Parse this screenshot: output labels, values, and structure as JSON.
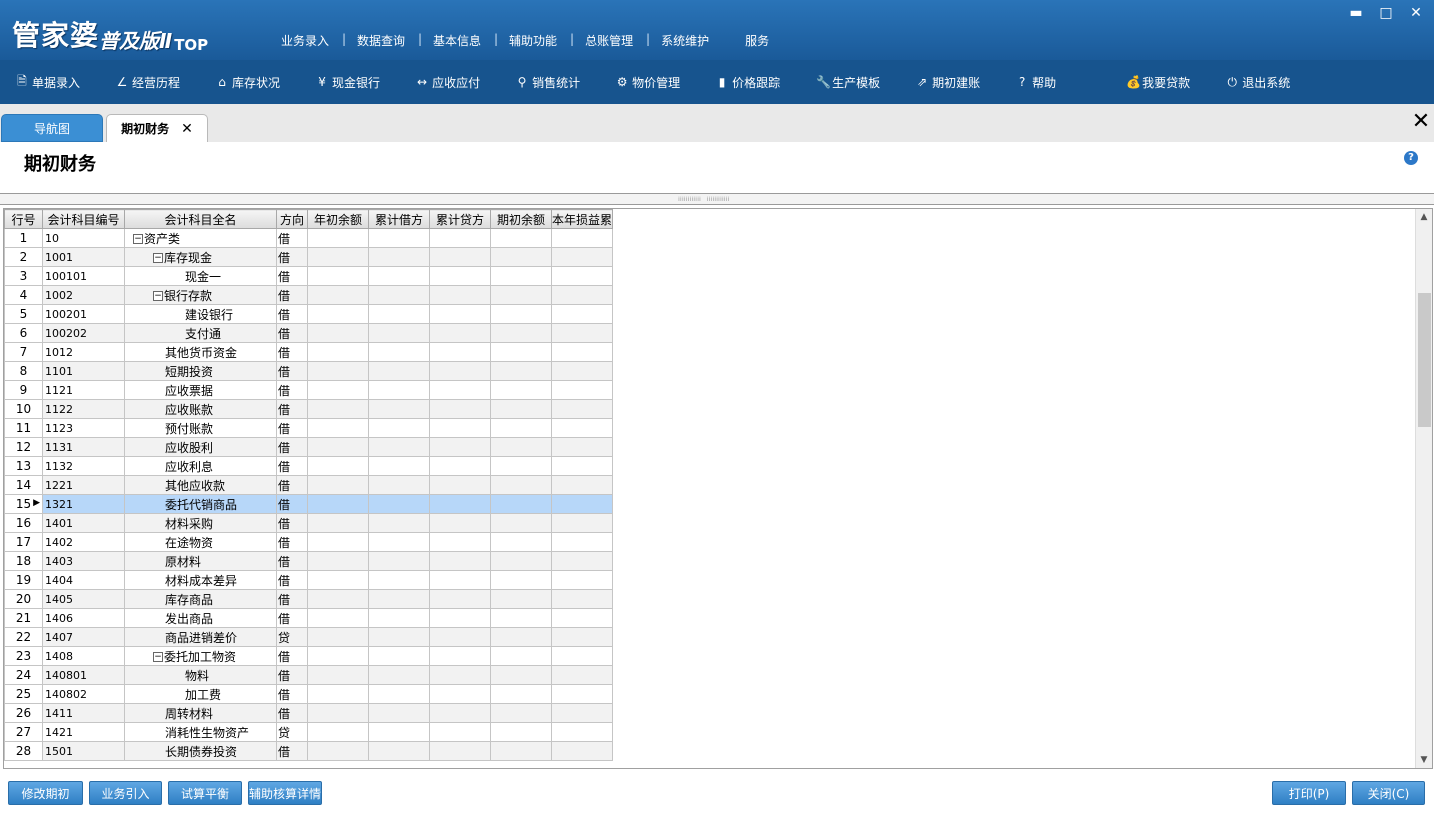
{
  "app": {
    "logo_main": "管家婆",
    "logo_sub": "普及版Ⅱ",
    "logo_top": "TOP"
  },
  "top_menu": [
    "业务录入",
    "数据查询",
    "基本信息",
    "辅助功能",
    "总账管理",
    "系统维护",
    "服务"
  ],
  "window_controls": {
    "minimize": "▬",
    "maximize": "□",
    "close": "✕"
  },
  "toolbar": [
    {
      "icon": "document-icon",
      "glyph": "🗎",
      "label": "单据录入"
    },
    {
      "icon": "line-chart-icon",
      "glyph": "∠",
      "label": "经营历程"
    },
    {
      "icon": "home-icon",
      "glyph": "⌂",
      "label": "库存状况"
    },
    {
      "icon": "yen-icon",
      "glyph": "¥",
      "label": "现金银行"
    },
    {
      "icon": "exchange-icon",
      "glyph": "↔",
      "label": "应收应付"
    },
    {
      "icon": "search-icon",
      "glyph": "⚲",
      "label": "销售统计"
    },
    {
      "icon": "gear-icon",
      "glyph": "⚙",
      "label": "物价管理"
    },
    {
      "icon": "bar-chart-icon",
      "glyph": "▮",
      "label": "价格跟踪"
    },
    {
      "icon": "wrench-icon",
      "glyph": "🔧",
      "label": "生产模板"
    },
    {
      "icon": "external-link-icon",
      "glyph": "⇗",
      "label": "期初建账"
    },
    {
      "icon": "question-icon",
      "glyph": "?",
      "label": "帮助"
    },
    {
      "icon": "money-bag-icon",
      "glyph": "💰",
      "label": "我要贷款"
    },
    {
      "icon": "power-icon",
      "glyph": "⏻",
      "label": "退出系统"
    }
  ],
  "tabs": {
    "nav": "导航图",
    "current": "期初财务",
    "close_glyph": "✕",
    "close_all_glyph": "✕"
  },
  "page": {
    "title": "期初财务",
    "help_glyph": "?"
  },
  "grid": {
    "headers": [
      "行号",
      "会计科目编号",
      "会计科目全名",
      "方向",
      "年初余额",
      "累计借方",
      "累计贷方",
      "期初余额",
      "本年损益累"
    ],
    "rows": [
      {
        "n": "1",
        "code": "10",
        "name": "资产类",
        "dir": "借",
        "level": 0,
        "toggle": "⊟"
      },
      {
        "n": "2",
        "code": "1001",
        "name": "库存现金",
        "dir": "借",
        "level": 1,
        "toggle": "⊟"
      },
      {
        "n": "3",
        "code": "100101",
        "name": "现金一",
        "dir": "借",
        "level": 2,
        "toggle": ""
      },
      {
        "n": "4",
        "code": "1002",
        "name": "银行存款",
        "dir": "借",
        "level": 1,
        "toggle": "⊟"
      },
      {
        "n": "5",
        "code": "100201",
        "name": "建设银行",
        "dir": "借",
        "level": 2,
        "toggle": ""
      },
      {
        "n": "6",
        "code": "100202",
        "name": "支付通",
        "dir": "借",
        "level": 2,
        "toggle": ""
      },
      {
        "n": "7",
        "code": "1012",
        "name": "其他货币资金",
        "dir": "借",
        "level": 1,
        "toggle": ""
      },
      {
        "n": "8",
        "code": "1101",
        "name": "短期投资",
        "dir": "借",
        "level": 1,
        "toggle": ""
      },
      {
        "n": "9",
        "code": "1121",
        "name": "应收票据",
        "dir": "借",
        "level": 1,
        "toggle": ""
      },
      {
        "n": "10",
        "code": "1122",
        "name": "应收账款",
        "dir": "借",
        "level": 1,
        "toggle": ""
      },
      {
        "n": "11",
        "code": "1123",
        "name": "预付账款",
        "dir": "借",
        "level": 1,
        "toggle": ""
      },
      {
        "n": "12",
        "code": "1131",
        "name": "应收股利",
        "dir": "借",
        "level": 1,
        "toggle": ""
      },
      {
        "n": "13",
        "code": "1132",
        "name": "应收利息",
        "dir": "借",
        "level": 1,
        "toggle": ""
      },
      {
        "n": "14",
        "code": "1221",
        "name": "其他应收款",
        "dir": "借",
        "level": 1,
        "toggle": ""
      },
      {
        "n": "15",
        "code": "1321",
        "name": "委托代销商品",
        "dir": "借",
        "level": 1,
        "toggle": "",
        "selected": true
      },
      {
        "n": "16",
        "code": "1401",
        "name": "材料采购",
        "dir": "借",
        "level": 1,
        "toggle": ""
      },
      {
        "n": "17",
        "code": "1402",
        "name": "在途物资",
        "dir": "借",
        "level": 1,
        "toggle": ""
      },
      {
        "n": "18",
        "code": "1403",
        "name": "原材料",
        "dir": "借",
        "level": 1,
        "toggle": ""
      },
      {
        "n": "19",
        "code": "1404",
        "name": "材料成本差异",
        "dir": "借",
        "level": 1,
        "toggle": ""
      },
      {
        "n": "20",
        "code": "1405",
        "name": "库存商品",
        "dir": "借",
        "level": 1,
        "toggle": ""
      },
      {
        "n": "21",
        "code": "1406",
        "name": "发出商品",
        "dir": "借",
        "level": 1,
        "toggle": ""
      },
      {
        "n": "22",
        "code": "1407",
        "name": "商品进销差价",
        "dir": "贷",
        "level": 1,
        "toggle": ""
      },
      {
        "n": "23",
        "code": "1408",
        "name": "委托加工物资",
        "dir": "借",
        "level": 1,
        "toggle": "⊟"
      },
      {
        "n": "24",
        "code": "140801",
        "name": "物料",
        "dir": "借",
        "level": 2,
        "toggle": ""
      },
      {
        "n": "25",
        "code": "140802",
        "name": "加工费",
        "dir": "借",
        "level": 2,
        "toggle": ""
      },
      {
        "n": "26",
        "code": "1411",
        "name": "周转材料",
        "dir": "借",
        "level": 1,
        "toggle": ""
      },
      {
        "n": "27",
        "code": "1421",
        "name": "消耗性生物资产",
        "dir": "贷",
        "level": 1,
        "toggle": ""
      },
      {
        "n": "28",
        "code": "1501",
        "name": "长期债券投资",
        "dir": "借",
        "level": 1,
        "toggle": ""
      }
    ]
  },
  "buttons": {
    "modify": "修改期初",
    "import": "业务引入",
    "trial": "试算平衡",
    "aux": "辅助核算详情",
    "print": "打印(P)",
    "close": "关闭(C)"
  }
}
